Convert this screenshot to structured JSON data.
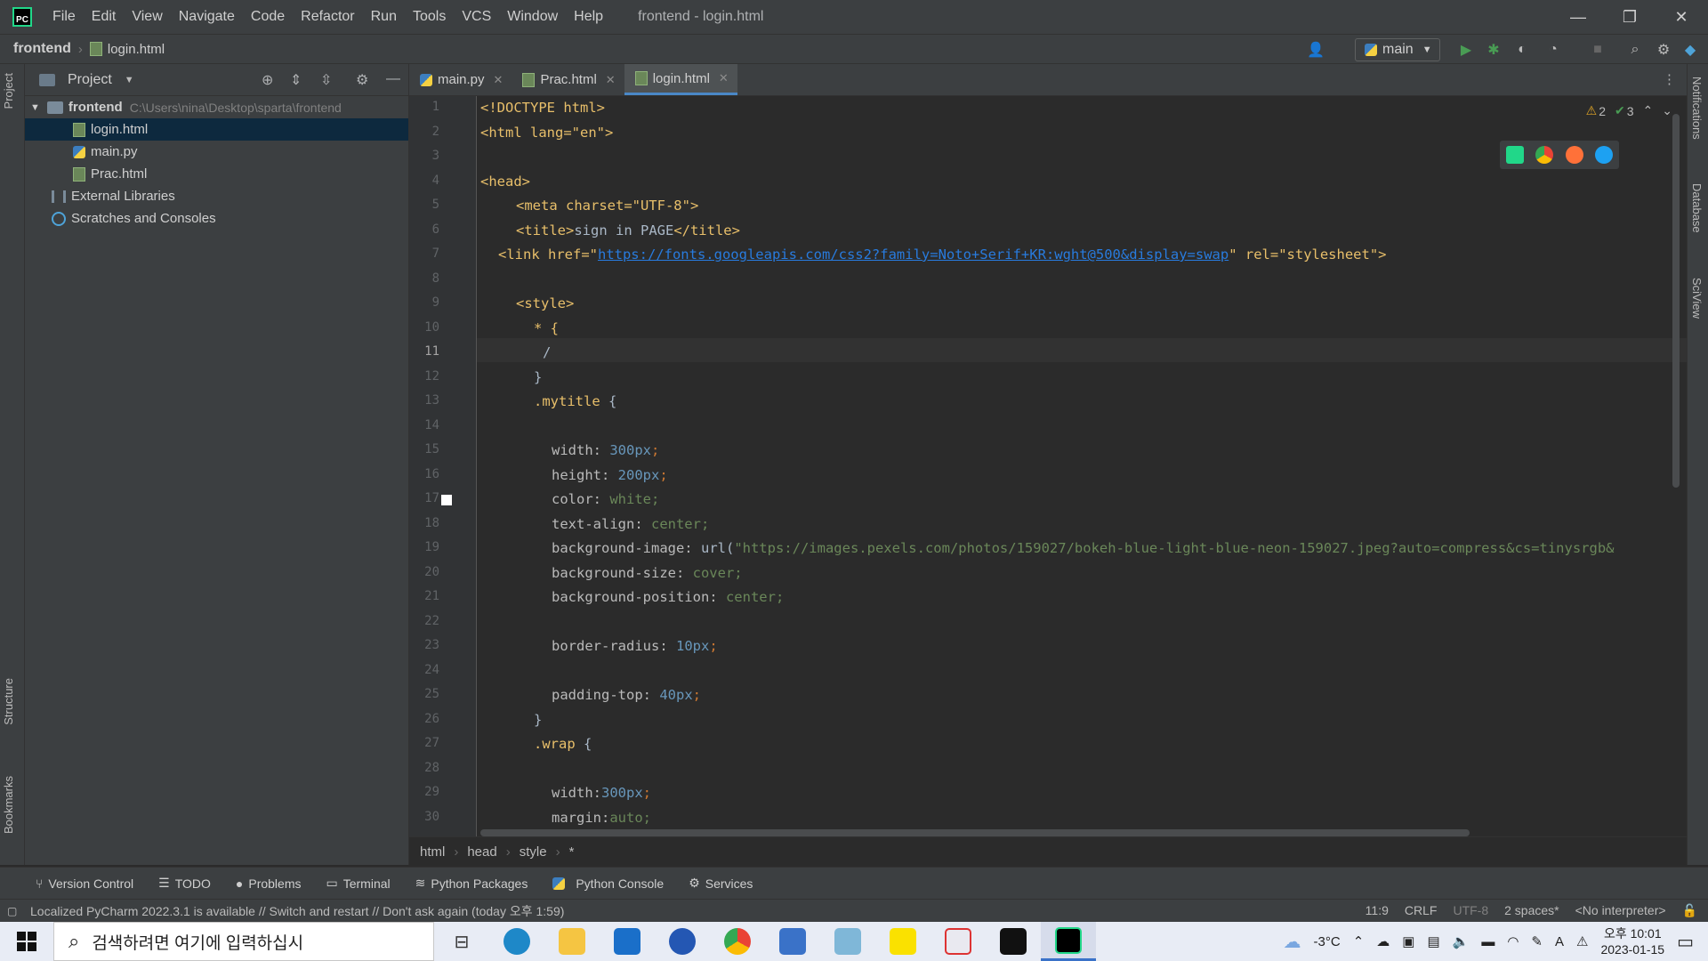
{
  "window": {
    "title": "frontend - login.html",
    "menu": [
      "File",
      "Edit",
      "View",
      "Navigate",
      "Code",
      "Refactor",
      "Run",
      "Tools",
      "VCS",
      "Window",
      "Help"
    ],
    "logo_text": "PC"
  },
  "navbar": {
    "project": "frontend",
    "file": "login.html",
    "run_config": "main"
  },
  "project_panel": {
    "title": "Project",
    "root": {
      "name": "frontend",
      "path": "C:\\Users\\nina\\Desktop\\sparta\\frontend"
    },
    "files": [
      "login.html",
      "main.py",
      "Prac.html"
    ],
    "external_libraries": "External Libraries",
    "scratches": "Scratches and Consoles"
  },
  "tabs": [
    {
      "label": "main.py",
      "type": "py"
    },
    {
      "label": "Prac.html",
      "type": "html"
    },
    {
      "label": "login.html",
      "type": "html",
      "active": true
    }
  ],
  "editor": {
    "warnings": "2",
    "checks": "3",
    "current_line": 11,
    "line_numbers": [
      "1",
      "2",
      "3",
      "4",
      "5",
      "6",
      "7",
      "8",
      "9",
      "10",
      "11",
      "12",
      "13",
      "14",
      "15",
      "16",
      "17",
      "18",
      "19",
      "20",
      "21",
      "22",
      "23",
      "24",
      "25",
      "26",
      "27",
      "28",
      "29",
      "30"
    ],
    "lines": {
      "l1": "<!DOCTYPE html>",
      "l2": "<html lang=\"en\">",
      "l4": "<head>",
      "l5": "<meta charset=\"UTF-8\">",
      "l6a": "<title>",
      "l6b": "sign in PAGE",
      "l6c": "</title>",
      "l7a": "<link href=\"",
      "l7b": "https://fonts.googleapis.com/css2?family=Noto+Serif+KR:wght@500&display=swap",
      "l7c": "\" rel=\"stylesheet\">",
      "l9": "<style>",
      "l10": "* {",
      "l11": "/",
      "l12": "}",
      "l13a": ".mytitle",
      "l13b": " {",
      "l15a": "width: ",
      "l15b": "300px",
      "l16a": "height: ",
      "l16b": "200px",
      "l17a": "color: ",
      "l17b": "white;",
      "l18a": "text-align: ",
      "l18b": "center;",
      "l19a": "background-image: ",
      "l19b": "url(",
      "l19c": "\"https://images.pexels.com/photos/159027/bokeh-blue-light-blue-neon-159027.jpeg?auto=compress&cs=tinysrgb&",
      "l20a": "background-size: ",
      "l20b": "cover;",
      "l21a": "background-position: ",
      "l21b": "center;",
      "l23a": "border-radius: ",
      "l23b": "10px",
      "l25a": "padding-top: ",
      "l25b": "40px",
      "l26": "}",
      "l27a": ".wrap",
      "l27b": " {",
      "l29a": "width:",
      "l29b": "300px",
      "l30a": "margin:",
      "l30b": "auto;",
      "semi": ";"
    }
  },
  "breadcrumb": [
    "html",
    "head",
    "style",
    "*"
  ],
  "right_strip": [
    "Notifications",
    "Database",
    "SciView"
  ],
  "left_strip": [
    "Project",
    "Structure",
    "Bookmarks"
  ],
  "bottom_tools": [
    "Version Control",
    "TODO",
    "Problems",
    "Terminal",
    "Python Packages",
    "Python Console",
    "Services"
  ],
  "status": {
    "message": "Localized PyCharm 2022.3.1 is available // Switch and restart // Don't ask again (today 오후 1:59)",
    "position": "11:9",
    "line_sep": "CRLF",
    "encoding": "UTF-8",
    "indent": "2 spaces*",
    "interpreter": "<No interpreter>"
  },
  "taskbar": {
    "search_placeholder": "검색하려면 여기에 입력하십시",
    "weather": "-3°C",
    "time": "오후 10:01",
    "date": "2023-01-15"
  },
  "colors": {
    "accent": "#4a88c7",
    "editor_bg": "#2b2b2b",
    "panel_bg": "#3c3f41",
    "selection": "#0d293e"
  }
}
